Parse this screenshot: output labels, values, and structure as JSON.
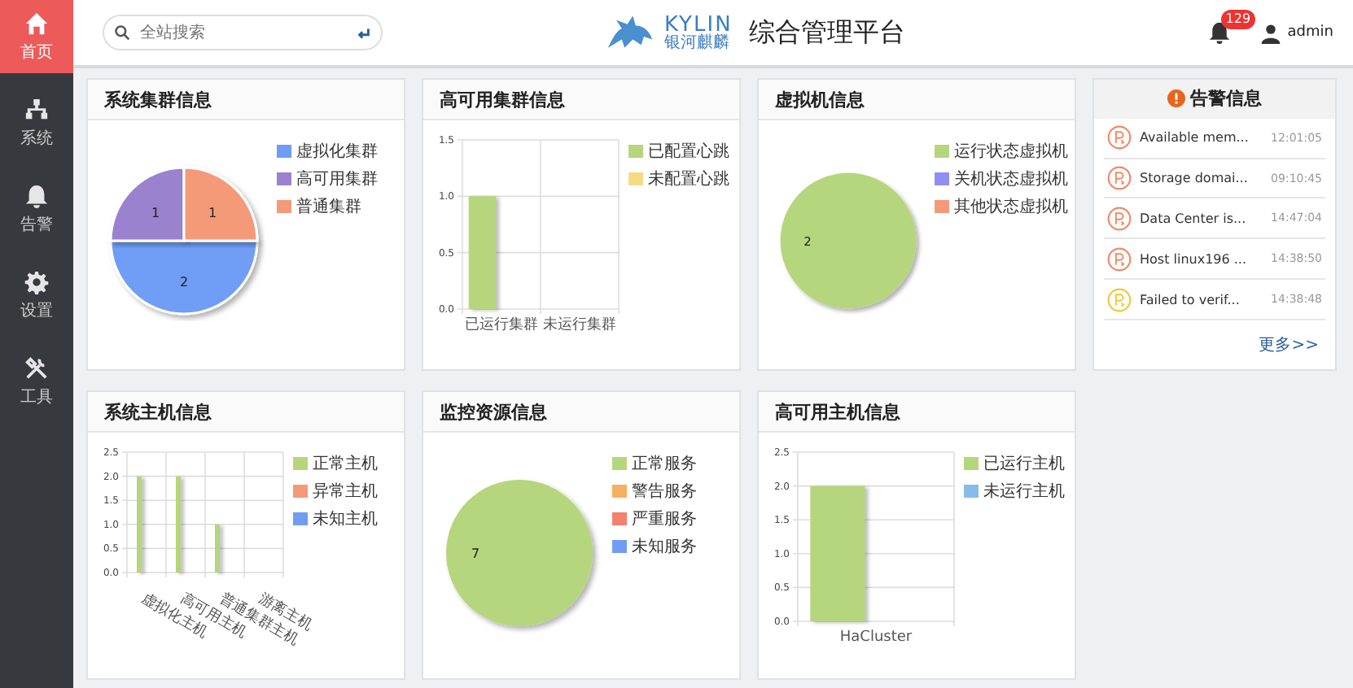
{
  "sidebar": {
    "items": [
      {
        "label": "首页",
        "selected": true
      },
      {
        "label": "系统",
        "selected": false
      },
      {
        "label": "告警",
        "selected": false
      },
      {
        "label": "设置",
        "selected": false
      },
      {
        "label": "工具",
        "selected": false
      }
    ]
  },
  "header": {
    "search": {
      "placeholder": "全站搜索"
    },
    "logo": {
      "name": "KYLIN",
      "subtitle": "银河麒麟"
    },
    "title": "综合管理平台",
    "notifications": "129",
    "user": "admin"
  },
  "panels": [
    {
      "title": "系统集群信息",
      "chart_data": {
        "type": "pie",
        "categories": [
          "虚拟化集群",
          "高可用集群",
          "普通集群"
        ],
        "values": [
          2,
          1,
          1
        ],
        "colors": [
          "#6f9df5",
          "#9b82cf",
          "#f49a78"
        ],
        "data_labels": true,
        "legend": "right"
      }
    },
    {
      "title": "高可用集群信息",
      "chart_data": {
        "type": "bar",
        "categories": [
          "已运行集群",
          "未运行集群"
        ],
        "series": [
          {
            "name": "已配置心跳",
            "color": "#b5d67c",
            "values": [
              1,
              0
            ]
          },
          {
            "name": "未配置心跳",
            "color": "#f5dc83",
            "values": [
              0,
              0
            ]
          }
        ],
        "ylim": [
          0,
          1.5
        ],
        "grid": true,
        "legend": "right",
        "yticks": [
          {
            "value": 0,
            "label": "0.0"
          },
          {
            "value": 0.5,
            "label": "0.5"
          },
          {
            "value": 1,
            "label": "1.0"
          },
          {
            "value": 1.5,
            "label": "1.5"
          }
        ]
      }
    },
    {
      "title": "虚拟机信息",
      "chart_data": {
        "type": "pie",
        "categories": [
          "运行状态虚拟机",
          "关机状态虚拟机",
          "其他状态虚拟机"
        ],
        "values": [
          2,
          0,
          0
        ],
        "colors": [
          "#b5d67c",
          "#8f8ff2",
          "#f49a78"
        ],
        "data_labels": true,
        "legend": "right"
      }
    },
    {
      "title": "系统主机信息",
      "chart_data": {
        "type": "bar",
        "categories": [
          "虚拟化主机",
          "高可用主机",
          "普通集群主机",
          "游离主机"
        ],
        "series": [
          {
            "name": "正常主机",
            "color": "#b5d67c",
            "values": [
              2,
              2,
              1,
              0
            ]
          },
          {
            "name": "异常主机",
            "color": "#f49a78",
            "values": [
              0,
              0,
              0,
              0
            ]
          },
          {
            "name": "未知主机",
            "color": "#6f9df5",
            "values": [
              0,
              0,
              0,
              0
            ]
          }
        ],
        "ylim": [
          0,
          2.5
        ],
        "grid": true,
        "legend": "right",
        "yticks": [
          {
            "value": 0,
            "label": "0.0"
          },
          {
            "value": 0.5,
            "label": "0.5"
          },
          {
            "value": 1,
            "label": "1.0"
          },
          {
            "value": 1.5,
            "label": "1.5"
          },
          {
            "value": 2,
            "label": "2.0"
          },
          {
            "value": 2.5,
            "label": "2.5"
          }
        ]
      }
    },
    {
      "title": "监控资源信息",
      "chart_data": {
        "type": "pie",
        "categories": [
          "正常服务",
          "警告服务",
          "严重服务",
          "未知服务"
        ],
        "values": [
          7,
          0,
          0,
          0
        ],
        "colors": [
          "#b5d67c",
          "#f5b060",
          "#f4806e",
          "#6f9df5"
        ],
        "data_labels": true,
        "legend": "right"
      }
    },
    {
      "title": "高可用主机信息",
      "chart_data": {
        "type": "bar",
        "categories": [
          "HaCluster"
        ],
        "series": [
          {
            "name": "已运行主机",
            "color": "#b5d67c",
            "values": [
              2
            ]
          },
          {
            "name": "未运行主机",
            "color": "#86bde8",
            "values": [
              0
            ]
          }
        ],
        "ylim": [
          0,
          2.5
        ],
        "grid": true,
        "legend": "right",
        "yticks": [
          {
            "value": 0,
            "label": "0.0"
          },
          {
            "value": 0.5,
            "label": "0.5"
          },
          {
            "value": 1,
            "label": "1.0"
          },
          {
            "value": 1.5,
            "label": "1.5"
          },
          {
            "value": 2,
            "label": "2.0"
          },
          {
            "value": 2.5,
            "label": "2.5"
          }
        ]
      }
    }
  ],
  "alerts": {
    "title": "告警信息",
    "items": [
      {
        "text": "Available mem...",
        "time": "12:01:05",
        "color": "#ef8a6a"
      },
      {
        "text": "Storage domai...",
        "time": "09:10:45",
        "color": "#ef8a6a"
      },
      {
        "text": "Data Center is...",
        "time": "14:47:04",
        "color": "#ef8a6a"
      },
      {
        "text": "Host linux196 ...",
        "time": "14:38:50",
        "color": "#ef8a6a"
      },
      {
        "text": "Failed to verif...",
        "time": "14:38:48",
        "color": "#f0c93a"
      }
    ],
    "more": "更多>>"
  }
}
